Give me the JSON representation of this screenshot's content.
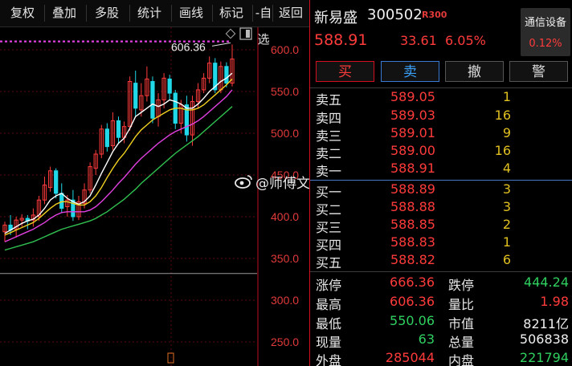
{
  "toolbar": {
    "items": [
      "复权",
      "叠加",
      "多股",
      "统计",
      "画线",
      "标记",
      "-自选",
      "返回"
    ]
  },
  "chart_data": {
    "type": "candlestick",
    "y_axis_ticks": [
      "600.0",
      "550.0",
      "500.0",
      "450.0",
      "400.0",
      "350.0",
      "300.0",
      "250.0"
    ],
    "ylim": [
      230,
      615
    ],
    "high_annotation": "606.36",
    "reference_price": 610,
    "candles": [
      {
        "o": 382,
        "h": 394,
        "l": 370,
        "c": 390
      },
      {
        "o": 390,
        "h": 402,
        "l": 378,
        "c": 384
      },
      {
        "o": 385,
        "h": 400,
        "l": 375,
        "c": 396
      },
      {
        "o": 396,
        "h": 403,
        "l": 388,
        "c": 398
      },
      {
        "o": 398,
        "h": 402,
        "l": 385,
        "c": 395
      },
      {
        "o": 396,
        "h": 410,
        "l": 388,
        "c": 402
      },
      {
        "o": 400,
        "h": 425,
        "l": 395,
        "c": 420
      },
      {
        "o": 420,
        "h": 448,
        "l": 415,
        "c": 438
      },
      {
        "o": 435,
        "h": 460,
        "l": 430,
        "c": 455
      },
      {
        "o": 455,
        "h": 458,
        "l": 422,
        "c": 428
      },
      {
        "o": 428,
        "h": 440,
        "l": 405,
        "c": 410
      },
      {
        "o": 412,
        "h": 426,
        "l": 400,
        "c": 420
      },
      {
        "o": 420,
        "h": 432,
        "l": 395,
        "c": 400
      },
      {
        "o": 400,
        "h": 425,
        "l": 396,
        "c": 418
      },
      {
        "o": 416,
        "h": 440,
        "l": 410,
        "c": 432
      },
      {
        "o": 432,
        "h": 465,
        "l": 428,
        "c": 460
      },
      {
        "o": 458,
        "h": 480,
        "l": 450,
        "c": 475
      },
      {
        "o": 475,
        "h": 510,
        "l": 470,
        "c": 505
      },
      {
        "o": 505,
        "h": 512,
        "l": 478,
        "c": 484
      },
      {
        "o": 485,
        "h": 525,
        "l": 480,
        "c": 515
      },
      {
        "o": 515,
        "h": 520,
        "l": 488,
        "c": 495
      },
      {
        "o": 495,
        "h": 514,
        "l": 488,
        "c": 508
      },
      {
        "o": 508,
        "h": 568,
        "l": 503,
        "c": 562
      },
      {
        "o": 560,
        "h": 575,
        "l": 520,
        "c": 530
      },
      {
        "o": 528,
        "h": 560,
        "l": 520,
        "c": 545
      },
      {
        "o": 545,
        "h": 580,
        "l": 538,
        "c": 565
      },
      {
        "o": 562,
        "h": 568,
        "l": 512,
        "c": 518
      },
      {
        "o": 520,
        "h": 548,
        "l": 508,
        "c": 540
      },
      {
        "o": 540,
        "h": 572,
        "l": 530,
        "c": 566
      },
      {
        "o": 565,
        "h": 570,
        "l": 540,
        "c": 548
      },
      {
        "o": 548,
        "h": 552,
        "l": 505,
        "c": 512
      },
      {
        "o": 512,
        "h": 540,
        "l": 500,
        "c": 534
      },
      {
        "o": 534,
        "h": 545,
        "l": 490,
        "c": 498
      },
      {
        "o": 498,
        "h": 545,
        "l": 485,
        "c": 538
      },
      {
        "o": 538,
        "h": 560,
        "l": 530,
        "c": 552
      },
      {
        "o": 552,
        "h": 572,
        "l": 548,
        "c": 566
      },
      {
        "o": 566,
        "h": 592,
        "l": 560,
        "c": 584
      },
      {
        "o": 584,
        "h": 590,
        "l": 548,
        "c": 552
      },
      {
        "o": 552,
        "h": 586,
        "l": 548,
        "c": 580
      },
      {
        "o": 580,
        "h": 585,
        "l": 555,
        "c": 560
      },
      {
        "o": 560,
        "h": 606.36,
        "l": 556,
        "c": 588.91
      }
    ],
    "ma": [
      {
        "color": "#ffffff",
        "values": [
          380,
          384,
          388,
          392,
          395,
          397,
          402,
          410,
          420,
          425,
          428,
          422,
          418,
          415,
          418,
          425,
          438,
          452,
          465,
          478,
          488,
          494,
          506,
          520,
          525,
          530,
          535,
          532,
          535,
          540,
          538,
          535,
          530,
          530,
          535,
          542,
          550,
          556,
          562,
          566,
          572
        ]
      },
      {
        "color": "#f0d020",
        "values": [
          378,
          381,
          384,
          387,
          390,
          393,
          398,
          404,
          410,
          415,
          418,
          418,
          416,
          414,
          414,
          418,
          425,
          435,
          447,
          458,
          468,
          476,
          486,
          496,
          504,
          510,
          516,
          520,
          524,
          528,
          530,
          530,
          528,
          528,
          530,
          534,
          540,
          546,
          552,
          558,
          565
        ]
      },
      {
        "color": "#e040e0",
        "values": [
          370,
          373,
          376,
          379,
          382,
          385,
          389,
          393,
          398,
          402,
          405,
          406,
          406,
          406,
          406,
          408,
          412,
          418,
          425,
          432,
          440,
          447,
          455,
          463,
          470,
          476,
          482,
          488,
          493,
          498,
          502,
          505,
          508,
          511,
          515,
          520,
          526,
          532,
          538,
          544,
          552
        ]
      },
      {
        "color": "#30c050",
        "values": [
          360,
          362,
          364,
          366,
          368,
          370,
          373,
          376,
          379,
          382,
          385,
          387,
          389,
          391,
          393,
          395,
          398,
          402,
          406,
          411,
          416,
          421,
          427,
          433,
          440,
          446,
          452,
          458,
          464,
          470,
          476,
          481,
          486,
          491,
          496,
          502,
          508,
          514,
          520,
          526,
          532
        ]
      }
    ]
  },
  "stock": {
    "name": "新易盛",
    "code": "300502",
    "badge": "R300",
    "price": "588.91",
    "change": "33.61",
    "change_pct": "6.05%"
  },
  "sector": {
    "name": "通信设备",
    "pct": "0.12%"
  },
  "trade_buttons": {
    "buy": "买",
    "sell": "卖",
    "cancel": "撤",
    "alert": "警"
  },
  "orderbook": {
    "asks": [
      {
        "label": "卖五",
        "price": "589.05",
        "vol": "1"
      },
      {
        "label": "卖四",
        "price": "589.03",
        "vol": "16"
      },
      {
        "label": "卖三",
        "price": "589.01",
        "vol": "9"
      },
      {
        "label": "卖二",
        "price": "589.00",
        "vol": "16"
      },
      {
        "label": "卖一",
        "price": "588.91",
        "vol": "4"
      }
    ],
    "bids": [
      {
        "label": "买一",
        "price": "588.89",
        "vol": "3"
      },
      {
        "label": "买二",
        "price": "588.88",
        "vol": "3"
      },
      {
        "label": "买三",
        "price": "588.85",
        "vol": "2"
      },
      {
        "label": "买四",
        "price": "588.83",
        "vol": "1"
      },
      {
        "label": "买五",
        "price": "588.82",
        "vol": "6"
      }
    ]
  },
  "stats": [
    {
      "l1": "涨停",
      "v1": "666.36",
      "c1": "red",
      "l2": "跌停",
      "v2": "444.24",
      "c2": "green"
    },
    {
      "l1": "最高",
      "v1": "606.36",
      "c1": "red",
      "l2": "量比",
      "v2": "1.98",
      "c2": "red"
    },
    {
      "l1": "最低",
      "v1": "550.06",
      "c1": "green",
      "l2": "市值",
      "v2": "8211亿",
      "c2": "white"
    },
    {
      "l1": "现量",
      "v1": "63",
      "c1": "green",
      "l2": "总量",
      "v2": "506838",
      "c2": "white"
    },
    {
      "l1": "外盘",
      "v1": "285044",
      "c1": "red",
      "l2": "内盘",
      "v2": "221794",
      "c2": "green"
    }
  ],
  "watermark": "@师傅文总",
  "colors": {
    "up": "#ff3b3b",
    "down": "#20d8e8",
    "accent": "#d01020"
  }
}
